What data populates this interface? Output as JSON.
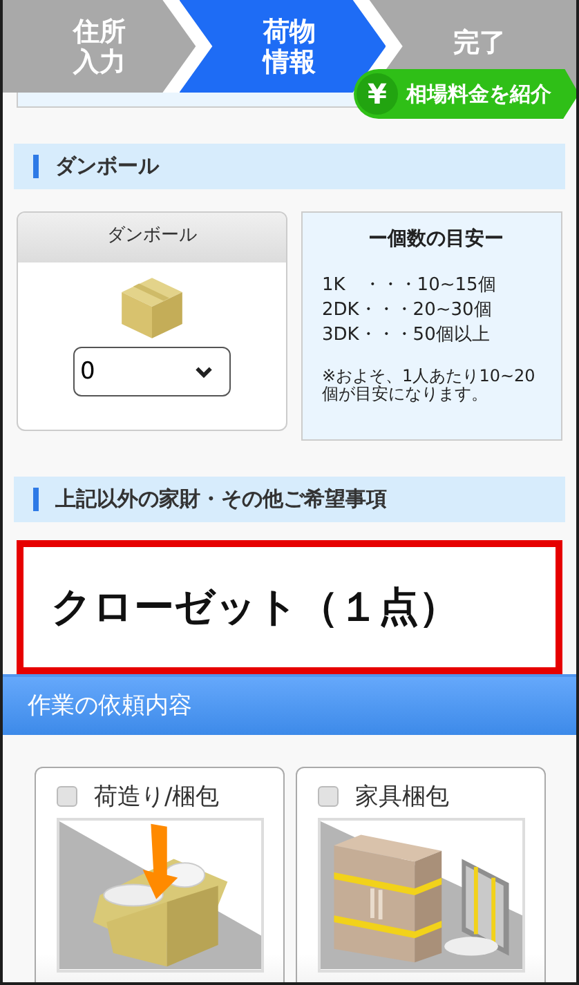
{
  "steps": [
    {
      "lines": [
        "住所",
        "入力"
      ],
      "selected": false
    },
    {
      "lines": [
        "荷物",
        "情報"
      ],
      "selected": true
    },
    {
      "lines": [
        "完了"
      ],
      "selected": false
    }
  ],
  "price_badge": {
    "symbol": "¥",
    "label": "相場料金を紹介"
  },
  "cardboard_section": {
    "heading": "ダンボール",
    "item": {
      "title": "ダンボール",
      "quantity": "0"
    },
    "guide": {
      "title": "ー個数の目安ー",
      "lines": [
        "1K　・・・10~15個",
        "2DK・・・20~30個",
        "3DK・・・50個以上"
      ],
      "note": "※およそ、1人あたり10~20個が目安になります。"
    }
  },
  "other_section": {
    "heading": "上記以外の家財・その他ご希望事項",
    "value": "クローゼット（１点）"
  },
  "work_section": {
    "heading": "作業の依頼内容",
    "options": [
      {
        "label": "荷造り/梱包",
        "checked": false,
        "kind": "packing"
      },
      {
        "label": "家具梱包",
        "checked": false,
        "kind": "furniture"
      }
    ]
  }
}
